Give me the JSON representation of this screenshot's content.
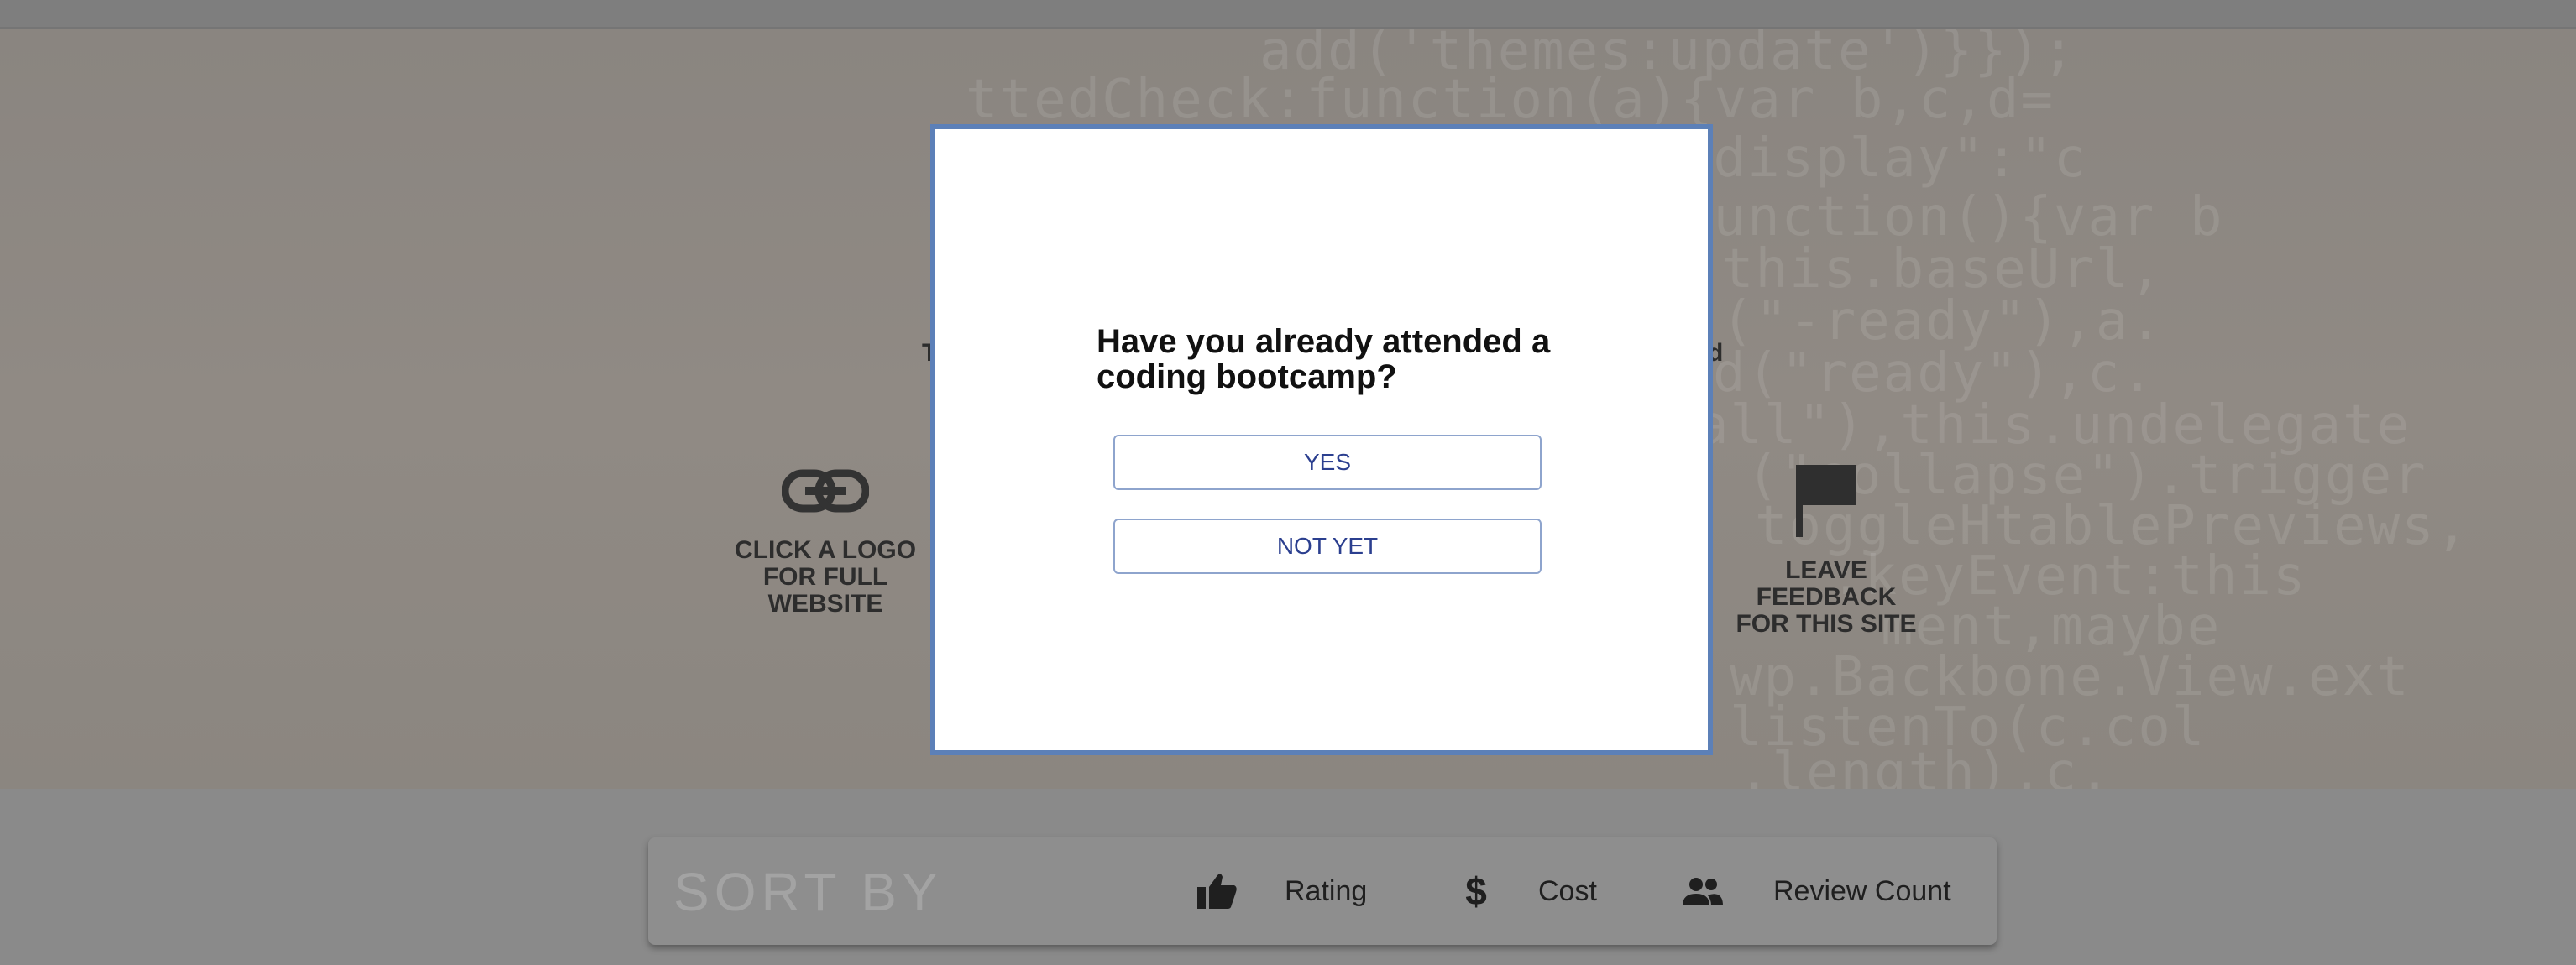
{
  "background": {
    "code_lines": [
      "add('themes:update')}});",
      "ttedCheck:function(a){var b,c,d=",
      "\"display\":\"c",
      "function(){var b",
      "this.baseUrl,",
      "(\"-ready\"),a.",
      "d(\"ready\"),c.",
      "all\"),this.undelegate",
      "(\"collapse\").trigger",
      "toggleHtablePreviews,",
      ".keyEvent:this",
      "ment,maybe",
      "wp.Backbone.View.ext",
      "listenTo(c.col",
      ".length),c."
    ]
  },
  "hero": {
    "left_tile": {
      "line1": "CLICK A LOGO",
      "line2": "FOR FULL WEBSITE"
    },
    "right_tile": {
      "line1": "LEAVE FEEDBACK",
      "line2": "FOR THIS SITE"
    },
    "frag_left": "T",
    "frag_right": "d"
  },
  "modal": {
    "question": "Have you already attended a coding bootcamp?",
    "yes_label": "YES",
    "no_label": "NOT YET"
  },
  "sort_bar": {
    "title": "SORT BY",
    "options": [
      {
        "label": "Rating",
        "icon": "thumbs-up-icon"
      },
      {
        "label": "Cost",
        "icon": "dollar-icon"
      },
      {
        "label": "Review Count",
        "icon": "people-icon"
      }
    ]
  },
  "colors": {
    "modal_border": "#5c80b8",
    "button_text": "#2b3f8f",
    "button_border": "#8ea4cd"
  }
}
